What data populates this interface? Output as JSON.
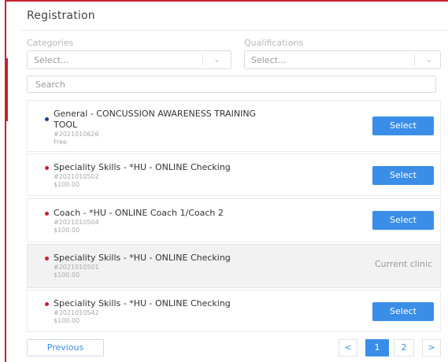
{
  "header": {
    "title": "Registration"
  },
  "filters": {
    "categories": {
      "label": "Categories",
      "placeholder": "Select..."
    },
    "qualifications": {
      "label": "Qualifications",
      "placeholder": "Select..."
    },
    "search_placeholder": "Search"
  },
  "clinics": [
    {
      "name": "General - CONCUSSION AWARENESS TRAINING",
      "name2": "TOOL",
      "code": "#2021010626",
      "price": "Free",
      "dot_color": "#1f3c8f",
      "action": "Select"
    },
    {
      "name": "Speciality Skills - *HU - ONLINE Checking",
      "code": "#2021010502",
      "price": "$100.00",
      "dot_color": "#c8202f",
      "action": "Select"
    },
    {
      "name": "Coach - *HU - ONLINE Coach 1/Coach 2",
      "code": "#2021010504",
      "price": "$100.00",
      "dot_color": "#c8202f",
      "action": "Select"
    },
    {
      "name": "Speciality Skills - *HU - ONLINE Checking",
      "code": "#2021010501",
      "price": "$100.00",
      "dot_color": "#c8202f",
      "status": "Current clinic"
    },
    {
      "name": "Speciality Skills - *HU - ONLINE Checking",
      "code": "#2021010542",
      "price": "$100.00",
      "dot_color": "#c8202f",
      "action": "Select"
    }
  ],
  "pagination": {
    "previous": "Previous",
    "prev_arrow": "<",
    "pages": [
      "1",
      "2"
    ],
    "next_arrow": ">",
    "current": "1"
  },
  "colors": {
    "accent": "#3b8ee8",
    "brand": "#c8202f"
  }
}
